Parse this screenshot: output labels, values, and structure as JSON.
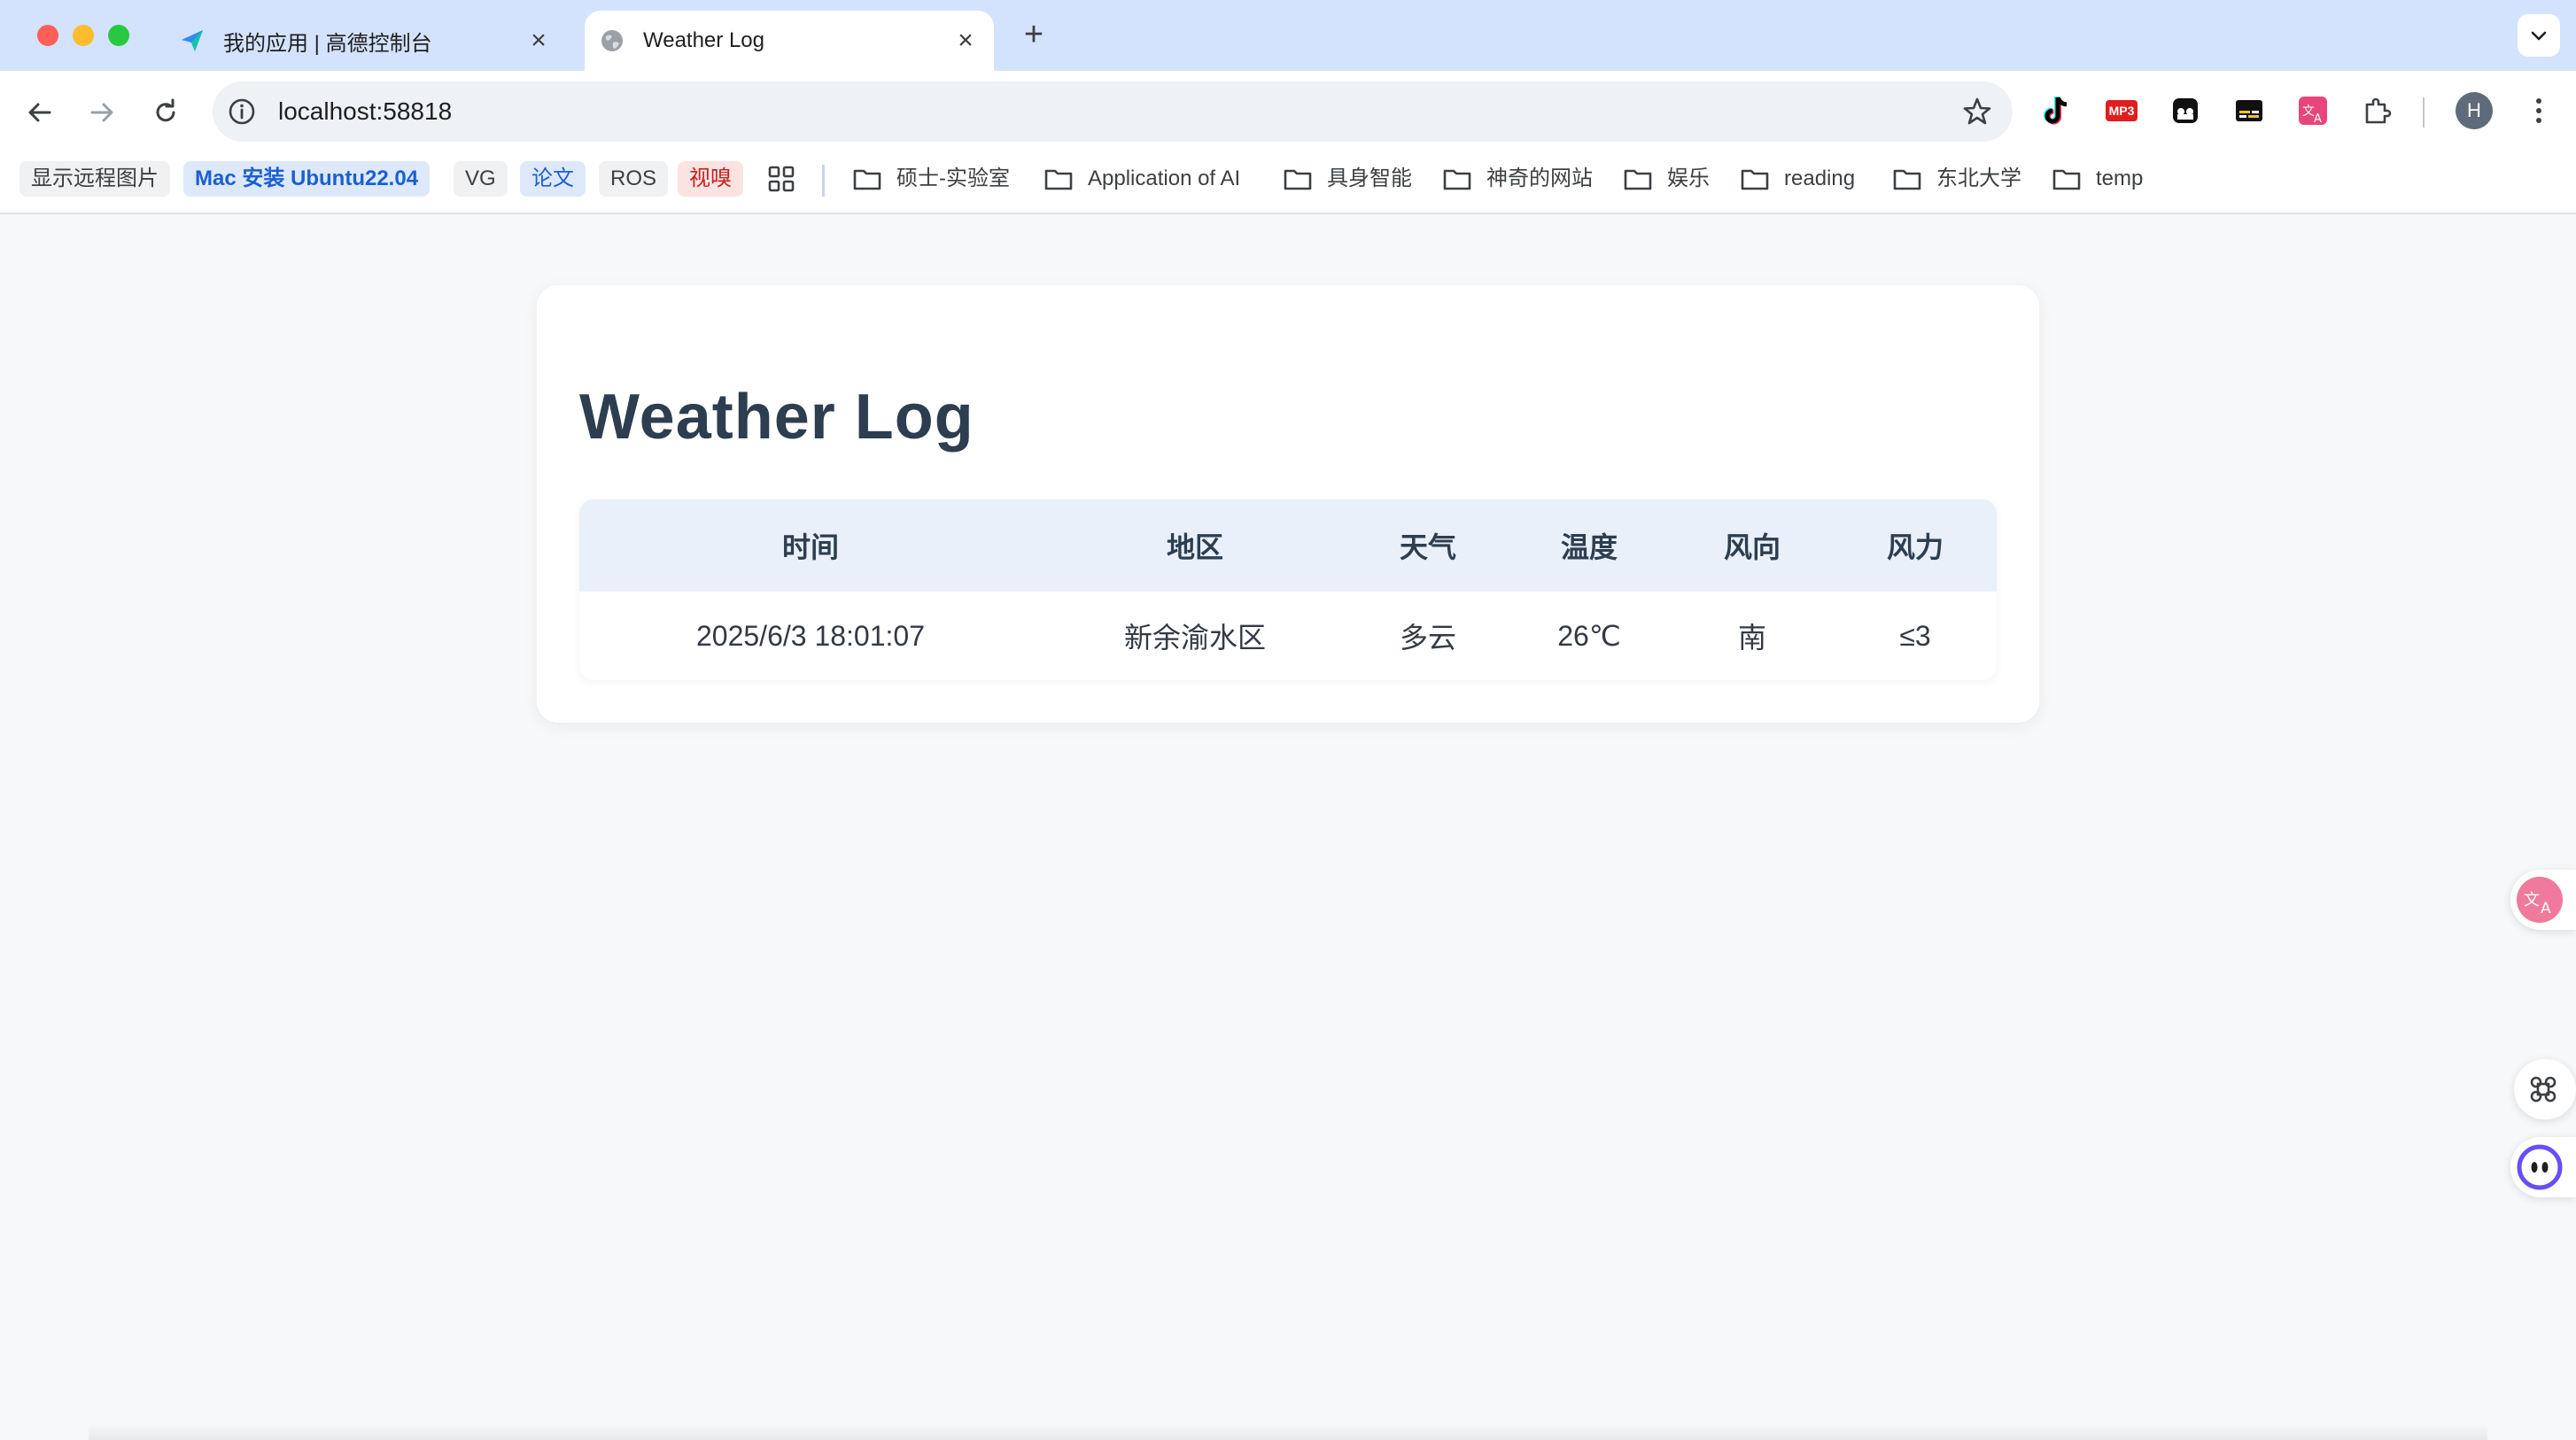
{
  "browser": {
    "tabs": [
      {
        "title": "我的应用 | 高德控制台",
        "icon": "amap-icon",
        "active": false
      },
      {
        "title": "Weather Log",
        "icon": "globe-icon",
        "active": true
      }
    ],
    "address": "localhost:58818",
    "profile_initial": "H",
    "extensions": [
      "tiktok-icon",
      "mp3-icon",
      "ghost-icon",
      "subtitle-icon",
      "translate-icon",
      "puzzle-icon"
    ],
    "ext_mp3_label": "MP3"
  },
  "bookmarks": {
    "chips": [
      {
        "label": "显示远程图片",
        "style": "gray"
      },
      {
        "label": "Mac 安装 Ubuntu22.04",
        "style": "blue"
      },
      {
        "label": "VG",
        "style": "gray"
      },
      {
        "label": "论文",
        "style": "blue2"
      },
      {
        "label": "ROS",
        "style": "gray"
      },
      {
        "label": "视嗅",
        "style": "red"
      }
    ],
    "folders": [
      "硕士-实验室",
      "Application of AI",
      "具身智能",
      "神奇的网站",
      "娱乐",
      "reading",
      "东北大学",
      "temp"
    ]
  },
  "page": {
    "title": "Weather Log",
    "columns": [
      "时间",
      "地区",
      "天气",
      "温度",
      "风向",
      "风力"
    ],
    "rows": [
      [
        "2025/6/3 18:01:07",
        "新余渝水区",
        "多云",
        "26℃",
        "南",
        "≤3"
      ]
    ]
  },
  "colors": {
    "tabstrip_bg": "#d3e3fd",
    "page_bg": "#f7f8fa",
    "heading": "#2c3e50",
    "table_header_bg": "#e9f0fa"
  }
}
